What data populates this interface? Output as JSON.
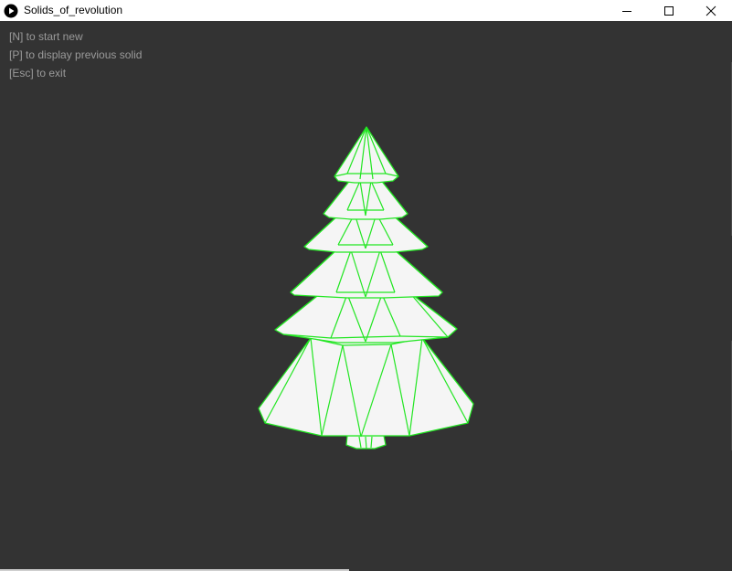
{
  "window": {
    "title": "Solids_of_revolution",
    "app_icon": "play-circle-icon",
    "controls": {
      "minimize_icon": "minimize-icon",
      "maximize_icon": "maximize-icon",
      "close_icon": "close-icon"
    }
  },
  "canvas": {
    "background": "#333333",
    "hints": [
      "[N] to start new",
      "[P] to display previous solid",
      "[Esc] to exit"
    ],
    "solid": {
      "shape": "tree-icon",
      "fill": "#f5f5f5",
      "wire_color": "#22e622"
    }
  }
}
